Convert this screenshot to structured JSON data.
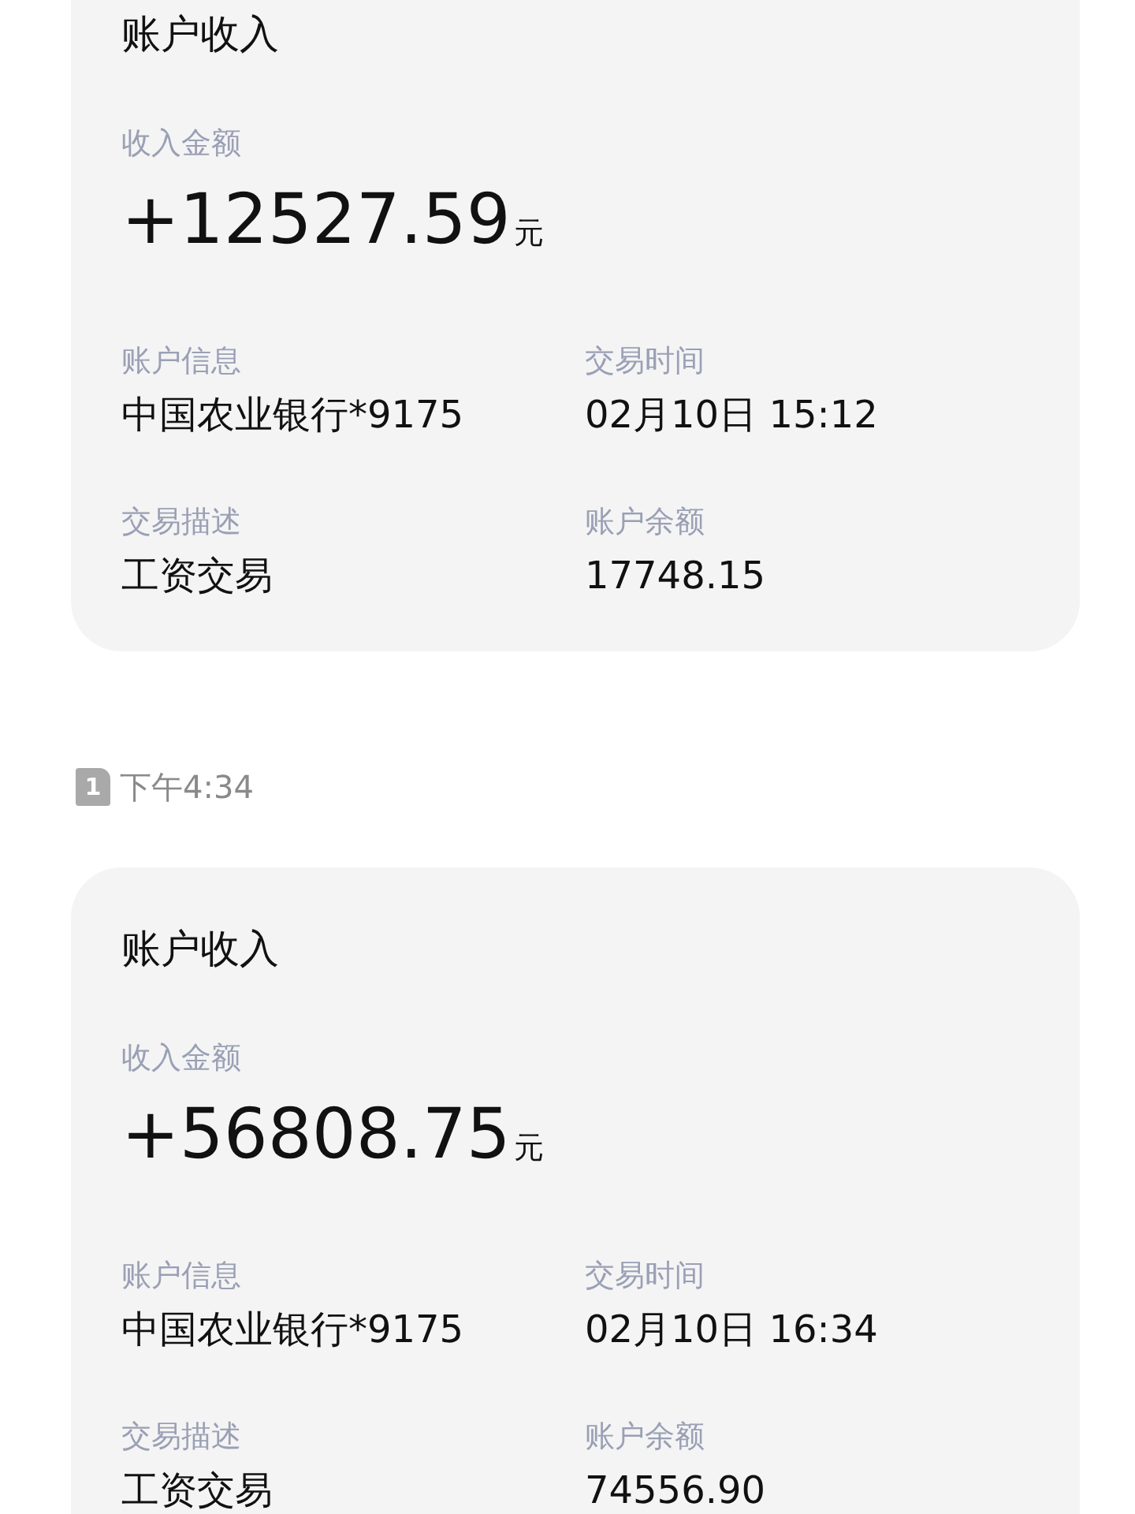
{
  "messages": [
    {
      "card": {
        "title": "账户收入",
        "amount_label": "收入金额",
        "amount": "+12527.59",
        "unit": "元",
        "fields": [
          {
            "label": "账户信息",
            "value": "中国农业银行*9175"
          },
          {
            "label": "交易时间",
            "value": "02月10日 15:12"
          },
          {
            "label": "交易描述",
            "value": "工资交易"
          },
          {
            "label": "账户余额",
            "value": "17748.15"
          }
        ]
      }
    },
    {
      "timestamp": {
        "sim": "1",
        "time": "下午4:34"
      },
      "card": {
        "title": "账户收入",
        "amount_label": "收入金额",
        "amount": "+56808.75",
        "unit": "元",
        "fields": [
          {
            "label": "账户信息",
            "value": "中国农业银行*9175"
          },
          {
            "label": "交易时间",
            "value": "02月10日 16:34"
          },
          {
            "label": "交易描述",
            "value": "工资交易"
          },
          {
            "label": "账户余额",
            "value": "74556.90"
          }
        ]
      }
    }
  ]
}
